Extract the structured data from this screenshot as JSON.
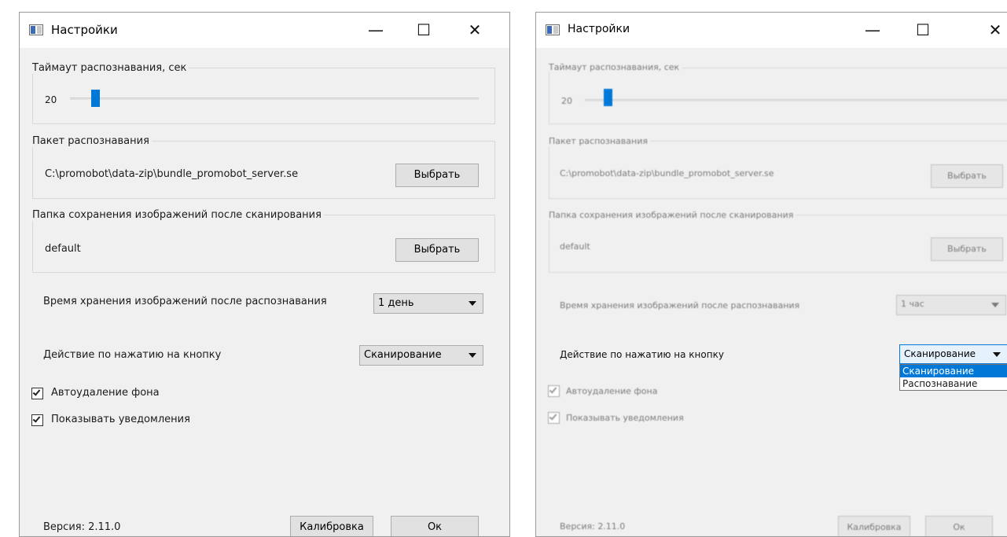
{
  "left_window": {
    "title": "Настройки",
    "caption": {
      "minimize": "—",
      "maximize": "☐",
      "close": "✕"
    },
    "timeout": {
      "title": "Таймаут распознавания, сек",
      "value": "20",
      "slider_level": 0.05
    },
    "bundle": {
      "title": "Пакет распознавания",
      "path": "C:\\promobot\\data-zip\\bundle_promobot_server.se",
      "choose_button": "Выбрать"
    },
    "folder": {
      "title": "Папка сохранения изображений после сканирования",
      "value": "default",
      "choose_button": "Выбрать"
    },
    "storage": {
      "label": "Время хранения изображений после распознавания",
      "selected": "1 день"
    },
    "action": {
      "label": "Действие по нажатию на кнопку",
      "selected": "Сканирование"
    },
    "checkboxes": [
      {
        "label": "Автоудаление фона",
        "checked": true
      },
      {
        "label": "Показывать уведомления",
        "checked": true
      }
    ],
    "version": "Версия: 2.11.0",
    "calibrate_button": "Калибровка",
    "ok_button": "Ок"
  },
  "right_window": {
    "title": "Настройки",
    "caption": {
      "minimize": "—",
      "maximize": "☐",
      "close": "✕"
    },
    "timeout": {
      "title": "Таймаут распознавания, сек",
      "value": "20",
      "slider_level": 0.05
    },
    "bundle": {
      "title": "Пакет распознавания",
      "path": "C:\\promobot\\data-zip\\bundle_promobot_server.se",
      "choose_button": "Выбрать"
    },
    "folder": {
      "title": "Папка сохранения изображений после сканирования",
      "value": "default",
      "choose_button": "Выбрать"
    },
    "storage": {
      "label": "Время хранения изображений после распознавания",
      "selected": "1 час"
    },
    "action": {
      "label": "Действие по нажатию на кнопку",
      "selected": "Сканирование",
      "options": [
        "Сканирование",
        "Распознавание"
      ],
      "highlighted": "Сканирование"
    },
    "checkboxes": [
      {
        "label": "Автоудаление фона",
        "checked": true
      },
      {
        "label": "Показывать уведомления",
        "checked": true
      }
    ],
    "version": "Версия: 2.11.0",
    "calibrate_button": "Калибровка",
    "ok_button": "Ок"
  },
  "colors": {
    "accent": "#0078d7",
    "window_bg": "#f0f0f0",
    "titlebar_bg": "#ffffff"
  }
}
